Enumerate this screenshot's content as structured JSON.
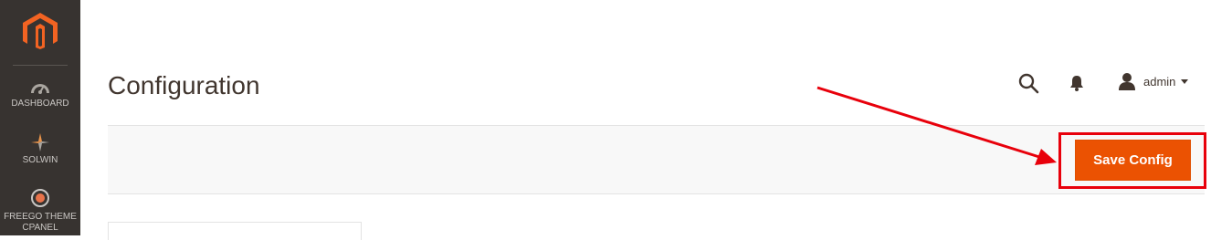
{
  "sidebar": {
    "logo": "magento-logo-icon",
    "items": [
      {
        "label": "DASHBOARD",
        "icon": "dashboard-gauge-icon"
      },
      {
        "label": "SOLWIN",
        "icon": "solwin-icon"
      },
      {
        "label": "FREEGO THEME CPANEL",
        "icon": "freego-target-icon"
      }
    ]
  },
  "header": {
    "title": "Configuration",
    "search_icon": "search-icon",
    "notifications_icon": "bell-icon",
    "user": {
      "name": "admin",
      "icon": "user-icon"
    }
  },
  "actions": {
    "save_label": "Save Config"
  },
  "annotation": {
    "highlight_color": "#e8000b",
    "target": "save-config-button"
  },
  "colors": {
    "accent": "#eb5202",
    "sidebar_bg": "#373330",
    "action_bar_bg": "#f8f8f8"
  }
}
